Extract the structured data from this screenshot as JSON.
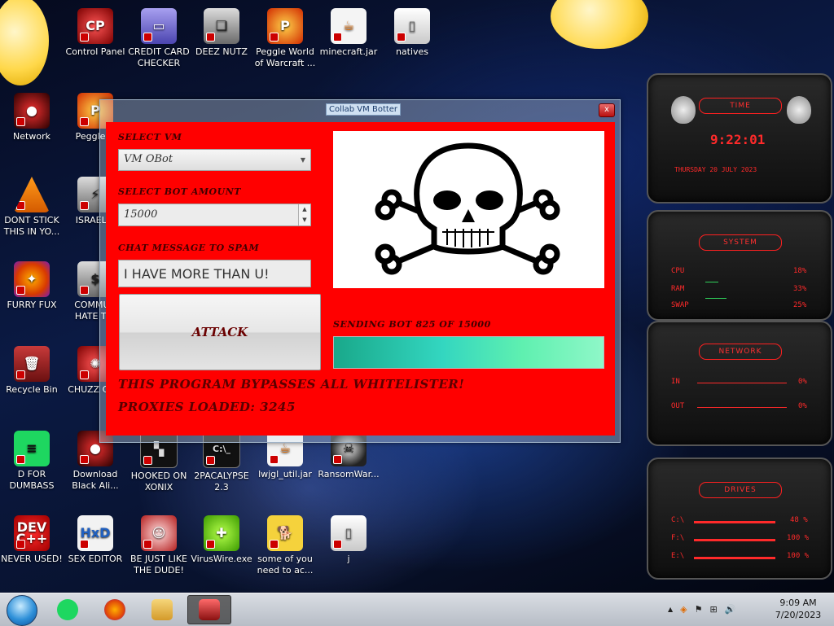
{
  "desktop": {
    "icons": [
      {
        "label": "Control Panel",
        "icon": "control-panel-icon"
      },
      {
        "label": "CREDIT CARD CHECKER",
        "icon": "credit-card-icon"
      },
      {
        "label": "DEEZ NUTZ",
        "icon": "stacked-windows-icon"
      },
      {
        "label": "Peggle World of Warcraft ...",
        "icon": "peggle-icon"
      },
      {
        "label": "minecraft.jar",
        "icon": "java-icon"
      },
      {
        "label": "natives",
        "icon": "folder-icon"
      },
      {
        "label": "Network",
        "icon": "alien-network-icon"
      },
      {
        "label": "Peggle D",
        "icon": "peggle-icon"
      },
      {
        "label": "DONT STICK THIS IN YO...",
        "icon": "vlc-cone-icon"
      },
      {
        "label": "ISRAEL S",
        "icon": "plug-icon"
      },
      {
        "label": "FURRY FUX",
        "icon": "firefox-icon"
      },
      {
        "label": "COMMUN HATE THI",
        "icon": "money-bag-icon"
      },
      {
        "label": "Recycle Bin",
        "icon": "recycle-bin-icon"
      },
      {
        "label": "CHUZZ CUM",
        "icon": "chuzzle-icon"
      },
      {
        "label": "D FOR DUMBASS",
        "icon": "spotify-icon"
      },
      {
        "label": "Download Black Ali...",
        "icon": "alien-download-icon"
      },
      {
        "label": "HOOKED ON XONIX",
        "icon": "xonix-icon"
      },
      {
        "label": "2PACALYPSE 2.3",
        "icon": "terminal-icon"
      },
      {
        "label": "lwjgl_util.jar",
        "icon": "java-icon"
      },
      {
        "label": "RansomWar...",
        "icon": "skull-icon"
      },
      {
        "label": "NEVER USED!",
        "icon": "dev-cpp-icon"
      },
      {
        "label": "SEX EDITOR",
        "icon": "hxd-icon"
      },
      {
        "label": "BE JUST LIKE THE DUDE!",
        "icon": "santa-icon"
      },
      {
        "label": "VirusWire.exe",
        "icon": "limewire-icon"
      },
      {
        "label": "some of you need to ac...",
        "icon": "dog-image-icon"
      },
      {
        "label": "j",
        "icon": "file-icon"
      }
    ],
    "glyphs": {
      "control_panel": "CP",
      "credit_card": "▭",
      "deez": "❏",
      "peggle": "P",
      "java": "☕",
      "natives": "▯",
      "network": "●",
      "vlc": "",
      "plug": "⚡",
      "firefox": "✦",
      "money": "$",
      "bin": "🗑",
      "chuzzle": "✺",
      "spotify": "≡",
      "alien": "●",
      "xonix": "▚",
      "terminal": "C:\\_",
      "skull": "☠",
      "dev": "DEV C++",
      "hxd": "HxD",
      "santa": "☺",
      "lime": "✚",
      "dog": "🐕",
      "file": "▯"
    }
  },
  "window": {
    "title": "Collab VM Botter",
    "close": "x",
    "select_vm_label": "SELECT VM",
    "select_vm_value": "VM OBot",
    "bot_amount_label": "SELECT BOT AMOUNT",
    "bot_amount_value": "15000",
    "chat_label": "CHAT MESSAGE TO SPAM",
    "chat_value": "I HAVE MORE THAN U!",
    "attack_label": "ATTACK",
    "status": "SENDING BOT 825 OF 15000",
    "progress_percent": 100,
    "bypass_text": "THIS PROGRAM BYPASSES ALL WHITELISTER!",
    "proxies_text": "PROXIES LOADED: 3245",
    "accent_color": "#ff0000"
  },
  "gadgets": {
    "time": {
      "title": "TIME",
      "clock": "9:22:01",
      "date": "THURSDAY 20 JULY 2023"
    },
    "system": {
      "title": "SYSTEM",
      "rows": [
        {
          "label": "CPU",
          "value": "18%"
        },
        {
          "label": "RAM",
          "value": "33%"
        },
        {
          "label": "SWAP",
          "value": "25%"
        }
      ]
    },
    "network": {
      "title": "NETWORK",
      "rows": [
        {
          "label": "IN",
          "value": "0%"
        },
        {
          "label": "OUT",
          "value": "0%"
        }
      ]
    },
    "drives": {
      "title": "DRIVES",
      "rows": [
        {
          "label": "C:\\",
          "value": "48 %"
        },
        {
          "label": "F:\\",
          "value": "100 %"
        },
        {
          "label": "E:\\",
          "value": "100 %"
        }
      ]
    }
  },
  "taskbar": {
    "apps": [
      {
        "name": "spotify-icon",
        "color": "#1ed760"
      },
      {
        "name": "firefox-icon",
        "color": "#ff7a00"
      },
      {
        "name": "file-explorer-icon",
        "color": "#e3b64a"
      },
      {
        "name": "monitor-app-icon",
        "color": "#d23a3a"
      }
    ],
    "tray": {
      "chevron": "▲",
      "flag": "⚑",
      "network": "⊞",
      "volume": "🔊",
      "app": "◈"
    },
    "time": "9:09 AM",
    "date": "7/20/2023"
  }
}
